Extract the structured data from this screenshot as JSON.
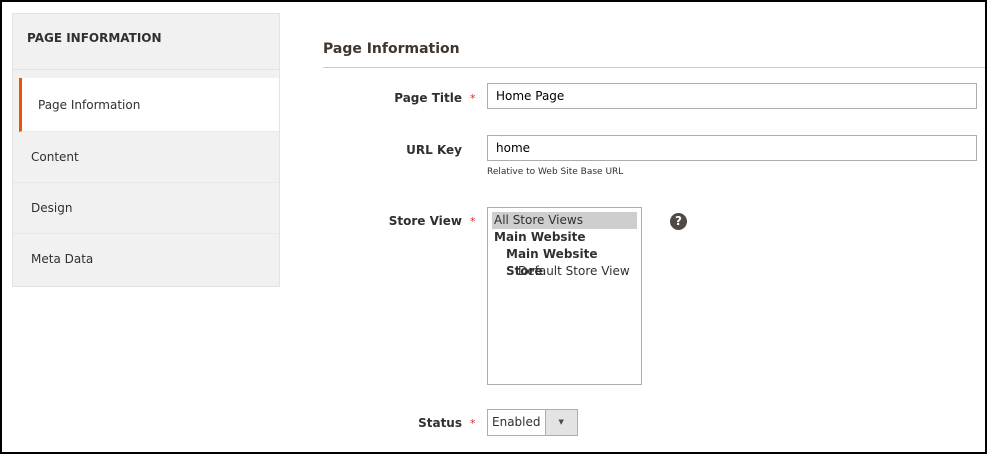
{
  "sidebar": {
    "title": "PAGE INFORMATION",
    "items": [
      {
        "label": "Page Information"
      },
      {
        "label": "Content"
      },
      {
        "label": "Design"
      },
      {
        "label": "Meta Data"
      }
    ]
  },
  "section": {
    "title": "Page Information"
  },
  "form": {
    "page_title": {
      "label": "Page Title",
      "value": "Home Page"
    },
    "url_key": {
      "label": "URL Key",
      "value": "home",
      "note": "Relative to Web Site Base URL"
    },
    "store_view": {
      "label": "Store View",
      "options": [
        "All Store Views",
        "Main Website",
        "Main Website Store",
        "Default Store View"
      ],
      "help": "?"
    },
    "status": {
      "label": "Status",
      "value": "Enabled",
      "arrow": "▼"
    },
    "required": "*"
  },
  "colors": {
    "accent": "#eb5202",
    "required": "#e22626"
  }
}
